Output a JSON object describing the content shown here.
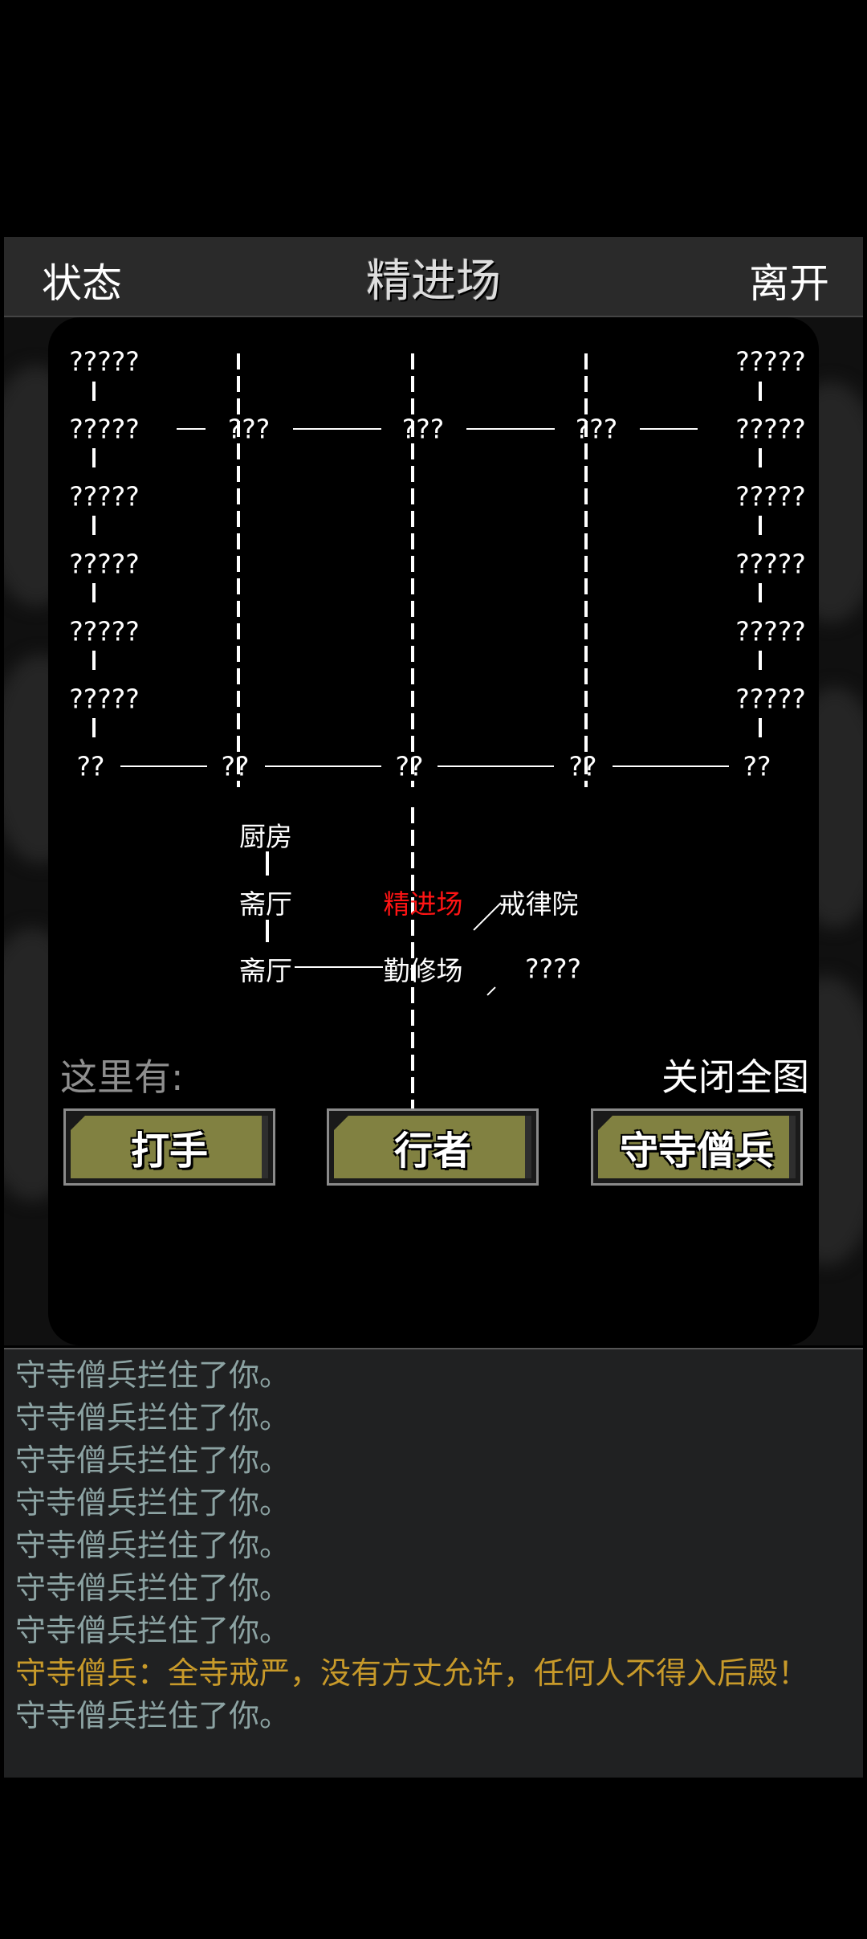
{
  "header": {
    "status_label": "状态",
    "title": "精进场",
    "leave_label": "离开"
  },
  "map": {
    "unknown5": "?????",
    "unknown3": "???",
    "unknown2": "??",
    "unknown4": "????",
    "rooms": {
      "kitchen": "厨房",
      "dining_a": "斋厅",
      "dining_b": "斋厅",
      "current": "精进场",
      "discipline_court": "戒律院",
      "diligence_field": "勤修场"
    }
  },
  "here": {
    "label": "这里有:",
    "close_map_label": "关闭全图",
    "npcs": [
      "打手",
      "行者",
      "守寺僧兵"
    ]
  },
  "log": {
    "lines": [
      "守寺僧兵拦住了你。",
      "守寺僧兵拦住了你。",
      "守寺僧兵拦住了你。",
      "守寺僧兵拦住了你。",
      "守寺僧兵拦住了你。",
      "守寺僧兵拦住了你。",
      "守寺僧兵拦住了你。",
      "守寺僧兵：全寺戒严，没有方丈允许，任何人不得入后殿！",
      "守寺僧兵拦住了你。"
    ]
  },
  "colors": {
    "current_room": "#ff1414",
    "log_text": "#8ca3a3",
    "speech_text": "#c89a2a",
    "npc_button": "#818141"
  }
}
